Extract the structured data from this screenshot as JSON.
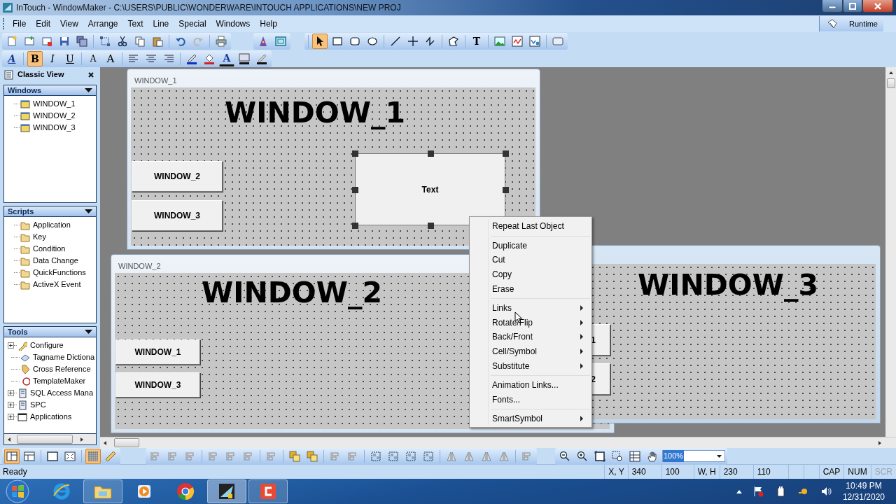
{
  "window": {
    "title": "InTouch - WindowMaker - C:\\USERS\\PUBLIC\\WONDERWARE\\INTOUCH APPLICATIONS\\NEW PROJ"
  },
  "menu": [
    "File",
    "Edit",
    "View",
    "Arrange",
    "Text",
    "Line",
    "Special",
    "Windows",
    "Help"
  ],
  "runtime_button": {
    "label": "Runtime"
  },
  "draw_tools": [
    {
      "selected": true
    },
    {
      "selected": false
    },
    {
      "selected": false
    },
    {
      "selected": false
    },
    {
      "selected": false
    },
    {
      "selected": false
    },
    {
      "selected": false
    },
    {
      "selected": false
    },
    {
      "selected": false,
      "label": "T"
    },
    {
      "selected": false
    },
    {
      "selected": false
    },
    {
      "selected": false
    },
    {
      "selected": false
    }
  ],
  "format_toolbar": {
    "font_button": {
      "label": "A"
    },
    "style_buttons": [
      {
        "label": "B",
        "selected": true
      },
      {
        "label": "I",
        "selected": false
      },
      {
        "label": "U",
        "selected": false
      }
    ],
    "size_buttons": [
      {
        "label": "A"
      },
      {
        "label": "A"
      }
    ],
    "text_color_button": {
      "label": "A"
    }
  },
  "sidebar": {
    "title": "Classic View",
    "sections": [
      {
        "title": "Windows",
        "items": [
          {
            "label": "WINDOW_1",
            "has_children": false
          },
          {
            "label": "WINDOW_2",
            "has_children": false
          },
          {
            "label": "WINDOW_3",
            "has_children": false
          }
        ]
      },
      {
        "title": "Scripts",
        "items": [
          {
            "label": "Application",
            "has_children": false
          },
          {
            "label": "Key",
            "has_children": false
          },
          {
            "label": "Condition",
            "has_children": false
          },
          {
            "label": "Data Change",
            "has_children": false
          },
          {
            "label": "QuickFunctions",
            "has_children": false
          },
          {
            "label": "ActiveX Event",
            "has_children": false
          }
        ]
      },
      {
        "title": "Tools",
        "items": [
          {
            "label": "Configure",
            "has_children": true
          },
          {
            "label": "Tagname Dictiona",
            "has_children": false
          },
          {
            "label": "Cross Reference",
            "has_children": false
          },
          {
            "label": "TemplateMaker",
            "has_children": false
          },
          {
            "label": "SQL Access Mana",
            "has_children": true
          },
          {
            "label": "SPC",
            "has_children": true
          },
          {
            "label": "Applications",
            "has_children": true
          }
        ]
      }
    ]
  },
  "canvas_windows": [
    {
      "title": "WINDOW_1",
      "heading": "WINDOW_1",
      "buttons": [
        {
          "label": "WINDOW_2"
        },
        {
          "label": "WINDOW_3"
        }
      ],
      "text_box": {
        "label": "Text",
        "selected": true
      }
    },
    {
      "title": "WINDOW_2",
      "heading": "WINDOW_2",
      "buttons": [
        {
          "label": "WINDOW_1"
        },
        {
          "label": "WINDOW_3"
        }
      ]
    },
    {
      "heading": "WINDOW_3",
      "buttons": [
        {
          "label": "1"
        },
        {
          "label": "2"
        }
      ]
    }
  ],
  "context_menu": [
    {
      "items": [
        {
          "label": "Repeat Last Object",
          "submenu": false
        }
      ]
    },
    {
      "items": [
        {
          "label": "Duplicate",
          "submenu": false
        },
        {
          "label": "Cut",
          "submenu": false
        },
        {
          "label": "Copy",
          "submenu": false
        },
        {
          "label": "Erase",
          "submenu": false
        }
      ]
    },
    {
      "items": [
        {
          "label": "Links",
          "submenu": true
        },
        {
          "label": "Rotate/Flip",
          "submenu": true
        },
        {
          "label": "Back/Front",
          "submenu": true
        },
        {
          "label": "Cell/Symbol",
          "submenu": true
        },
        {
          "label": "Substitute",
          "submenu": true
        }
      ]
    },
    {
      "items": [
        {
          "label": "Animation Links...",
          "submenu": false
        },
        {
          "label": "Fonts...",
          "submenu": false
        }
      ]
    },
    {
      "items": [
        {
          "label": "SmartSymbol",
          "submenu": true
        }
      ]
    }
  ],
  "view_tools": [
    {
      "selected": true
    },
    {
      "selected": false
    },
    {
      "selected": false
    },
    {
      "selected": false
    },
    {
      "selected": true
    },
    {
      "selected": false
    }
  ],
  "zoom": {
    "value": "100%"
  },
  "status_bar": {
    "text": "Ready",
    "cells": [
      "X, Y",
      "340",
      "100",
      "W, H",
      "230",
      "110"
    ],
    "indicators": [
      {
        "label": "CAP",
        "on": true
      },
      {
        "label": "NUM",
        "on": true
      },
      {
        "label": "SCR",
        "on": false
      }
    ]
  },
  "taskbar": {
    "apps": [
      {
        "open": false,
        "selected": false
      },
      {
        "open": true,
        "selected": false
      },
      {
        "open": false,
        "selected": false
      },
      {
        "open": false,
        "selected": false
      },
      {
        "open": true,
        "selected": true
      },
      {
        "open": true,
        "selected": false
      }
    ],
    "time": "10:49 PM",
    "date": "12/31/2020"
  }
}
